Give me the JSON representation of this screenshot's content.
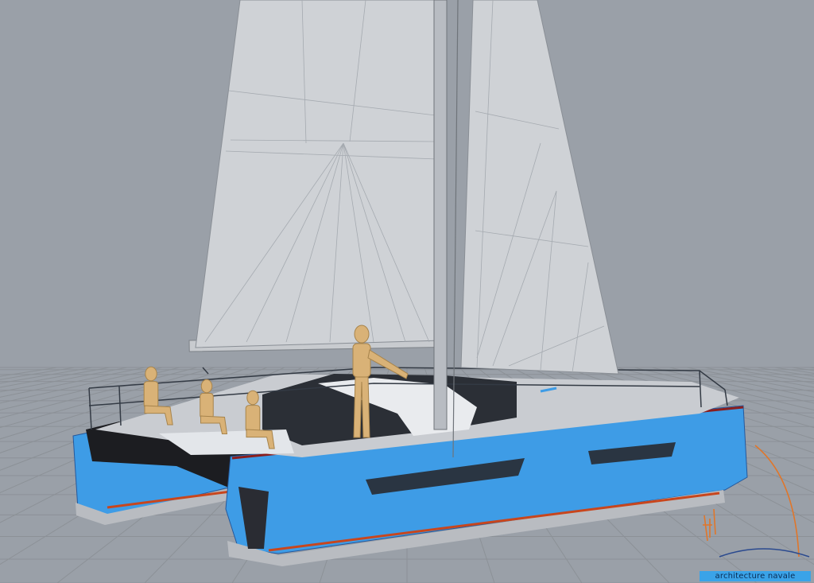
{
  "viewport": {
    "background": "#9aa0a8",
    "grid_color": "#8c9197",
    "hull_color": "#3e9ce6",
    "sail_color": "#cfd2d6",
    "figure_color": "#d9b277",
    "rail_color": "#333a44"
  },
  "brand": {
    "label": "architecture navale",
    "color": "#3aa3e8"
  },
  "icons": [
    "designer-signature-logo"
  ]
}
